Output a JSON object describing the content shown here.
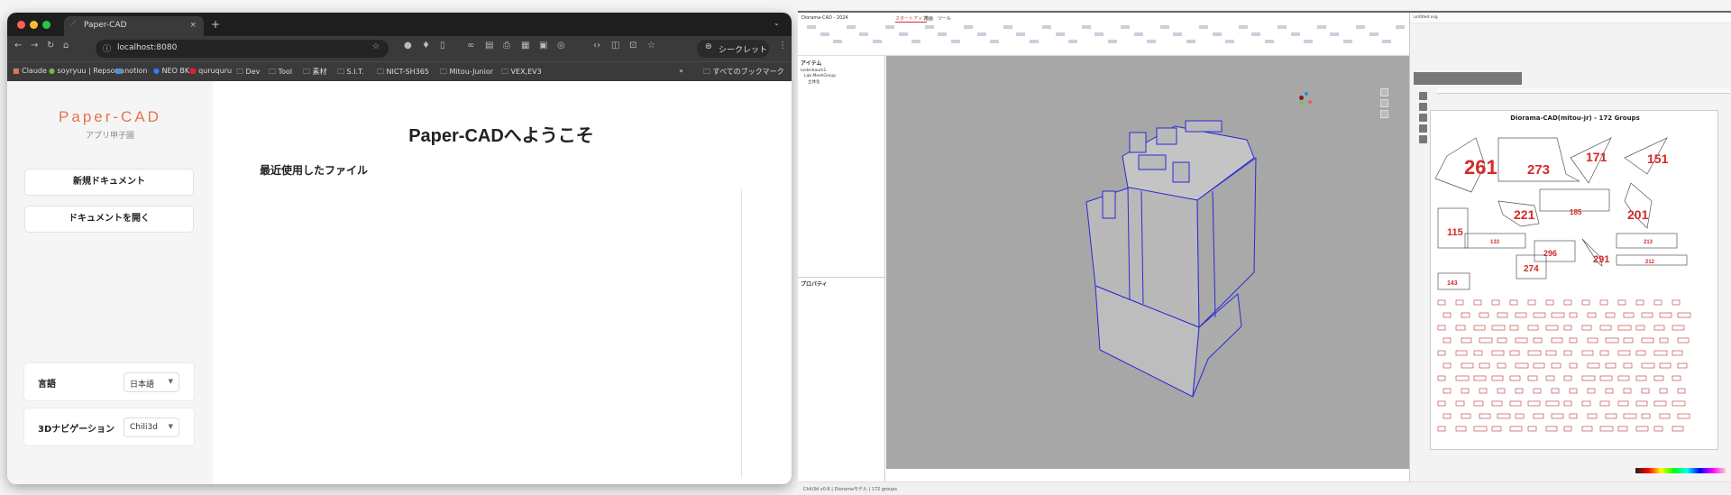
{
  "browser": {
    "tab_title": "Paper-CAD",
    "url": "localhost:8080",
    "incognito_label": "シークレット",
    "bookmarks": [
      "Claude",
      "soyryuu | Repsona",
      "notion",
      "NEO BK",
      "quruquru",
      "Dev",
      "Tool",
      "素材",
      "S.I.T.",
      "NICT-SH365",
      "Mitou-Junior",
      "VEX,EV3"
    ],
    "all_bookmarks": "すべてのブックマーク"
  },
  "app": {
    "logo": "Paper-CAD",
    "subtitle": "アプリ甲子園",
    "new_document": "新規ドキュメント",
    "open_document": "ドキュメントを開く",
    "welcome_title": "Paper-CADへようこそ",
    "recent_files": "最近使用したファイル",
    "settings": [
      {
        "label": "言語",
        "value": "日本語"
      },
      {
        "label": "3Dナビゲーション",
        "value": "Chili3d"
      }
    ]
  },
  "cad": {
    "title": "Diorama-CAD - 2024",
    "ribbon_tabs": [
      "スタートアップ",
      "描画",
      "ツール"
    ],
    "items_panel": "アイテム",
    "tree": [
      "Lederbaum1",
      "Lab.MeshGroup",
      "立体化"
    ],
    "properties_panel": "プロパティ",
    "layout_tab": "untitled.svg",
    "layout_title": "Diorama-CAD(mitou-jr) - 172 Groups",
    "pieces": [
      "261",
      "273",
      "171",
      "151",
      "221",
      "185",
      "201",
      "115",
      "133",
      "296",
      "291",
      "213",
      "274",
      "212",
      "143"
    ],
    "status": "Chili3d v0.6 | Dioramaモデル | 172 groups"
  }
}
